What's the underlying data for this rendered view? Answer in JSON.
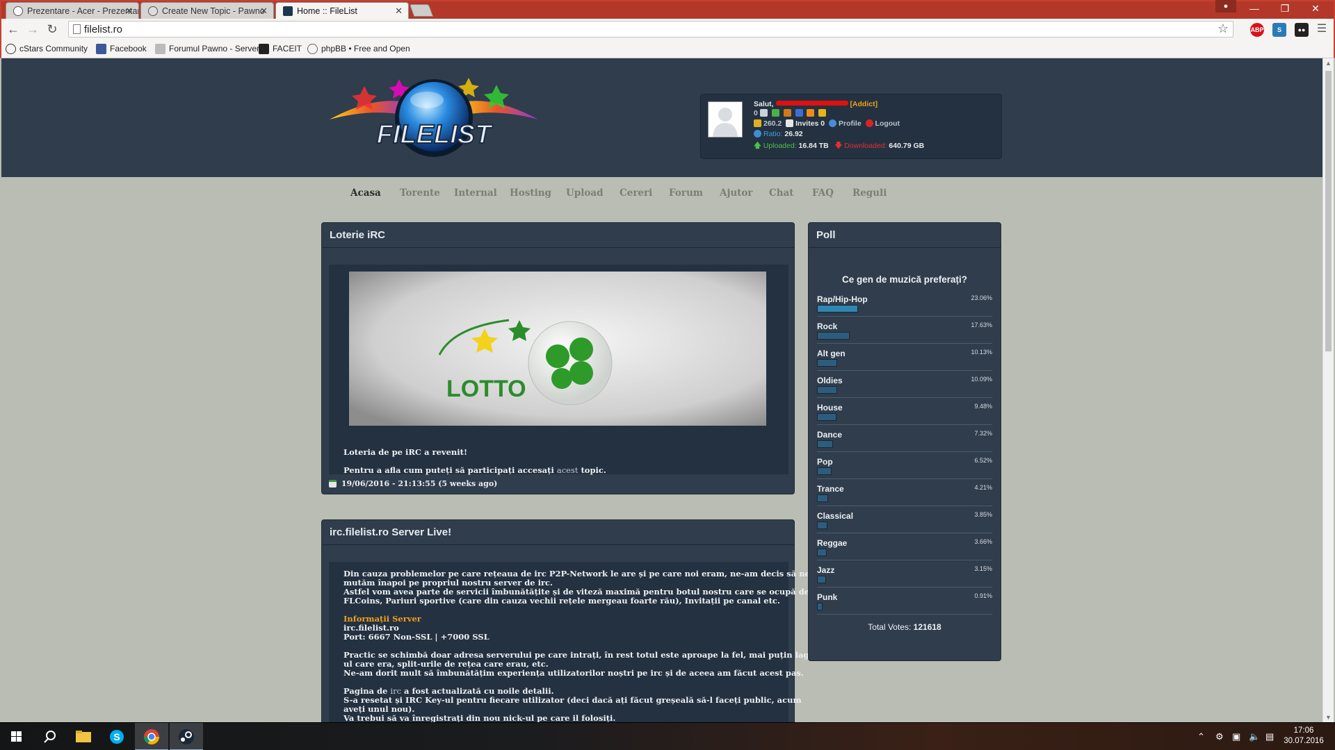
{
  "browser": {
    "tabs": [
      {
        "title": "Prezentare - Acer - Prezentare"
      },
      {
        "title": "Create New Topic - Pawno"
      },
      {
        "title": "Home :: FileList"
      }
    ],
    "url": "filelist.ro",
    "bookmarks": [
      {
        "label": "cStars Community"
      },
      {
        "label": "Facebook"
      },
      {
        "label": "Forumul Pawno - Server"
      },
      {
        "label": "FACEIT"
      },
      {
        "label": "phpBB • Free and Open"
      }
    ],
    "extensions": {
      "abp": "ABP"
    }
  },
  "site": {
    "logo_text": "FILELIST",
    "user": {
      "greeting": "Salut,",
      "class": "[Addict]",
      "messages": "0",
      "bonus": "260.2",
      "invites": "Invites 0",
      "profile": "Profile",
      "logout": "Logout",
      "ratio_label": "Ratio:",
      "ratio": "26.92",
      "uploaded_label": "Uploaded:",
      "uploaded": "16.84 TB",
      "downloaded_label": "Downloaded:",
      "downloaded": "640.79 GB"
    },
    "nav": [
      "Acasa",
      "Torente",
      "Internal",
      "Hosting",
      "Upload",
      "Cereri",
      "Forum",
      "Ajutor",
      "Chat",
      "FAQ",
      "Reguli"
    ],
    "news": [
      {
        "title": "Loterie iRC",
        "image_text": "LOTTO",
        "line1": "Loteria de pe iRC a revenit!",
        "line2_pre": "Pentru a afla cum puteți să participați accesați",
        "line2_link": "acest",
        "line2_post": "topic.",
        "date": "19/06/2016 - 21:13:55 (5 weeks ago)"
      },
      {
        "title": "irc.filelist.ro Server Live!",
        "p1a": "Din cauza problemelor pe care rețeaua de irc P2P-Network le are și pe care noi eram, ne-am decis să ne",
        "p1b": "mutăm înapoi pe propriul nostru server de irc.",
        "p1c": "Astfel vom avea parte de servicii îmbunătățite și de viteză maximă pentru botul nostru care se ocupă de",
        "p1d": "FLCoins, Pariuri sportive (care din cauza vechii rețele mergeau foarte rău), Invitații pe canal etc.",
        "info_title": "Informații Server",
        "info_host": "irc.filelist.ro",
        "info_port": "Port: 6667 Non-SSL | +7000 SSL",
        "p2a": "Practic se schimbă doar adresa serverului pe care intrați, în rest totul este aproape la fel, mai puțin lag-",
        "p2b": "ul care era, split-urile de rețea care erau, etc.",
        "p2c": "Ne-am dorit mult să îmbunătățim experiența utilizatorilor noștri pe irc și de aceea am făcut acest pas.",
        "p3a_pre": "Pagina de",
        "p3a_link": "irc",
        "p3a_post": "a fost actualizată cu noile detalii.",
        "p3b": "S-a resetat și IRC Key-ul pentru fiecare utilizator (deci dacă ați făcut greșeală să-l faceți public, acum",
        "p3c": "aveți unul nou).",
        "p3d": "Va trebui să va înregistrați din nou nick-ul pe care il folosiți."
      }
    ],
    "poll": {
      "title": "Poll",
      "question": "Ce gen de muzică preferați?",
      "options": [
        {
          "label": "Rap/Hip-Hop",
          "percent": "23.06%",
          "value": 23.06
        },
        {
          "label": "Rock",
          "percent": "17.63%",
          "value": 17.63
        },
        {
          "label": "Alt gen",
          "percent": "10.13%",
          "value": 10.13
        },
        {
          "label": "Oldies",
          "percent": "10.09%",
          "value": 10.09
        },
        {
          "label": "House",
          "percent": "9.48%",
          "value": 9.48
        },
        {
          "label": "Dance",
          "percent": "7.32%",
          "value": 7.32
        },
        {
          "label": "Pop",
          "percent": "6.52%",
          "value": 6.52
        },
        {
          "label": "Trance",
          "percent": "4.21%",
          "value": 4.21
        },
        {
          "label": "Classical",
          "percent": "3.85%",
          "value": 3.85
        },
        {
          "label": "Reggae",
          "percent": "3.66%",
          "value": 3.66
        },
        {
          "label": "Jazz",
          "percent": "3.15%",
          "value": 3.15
        },
        {
          "label": "Punk",
          "percent": "0.91%",
          "value": 0.91
        }
      ],
      "total_label": "Total Votes:",
      "total": "121618"
    }
  },
  "taskbar": {
    "time": "17:06",
    "date": "30.07.2016"
  },
  "colors": {
    "header_bg": "#2f3d4d",
    "page_bg": "#b9bdb3",
    "accent_orange": "#f2a019",
    "poll_bar": "#2d5d7e",
    "chrome_frame": "#c8402f"
  }
}
